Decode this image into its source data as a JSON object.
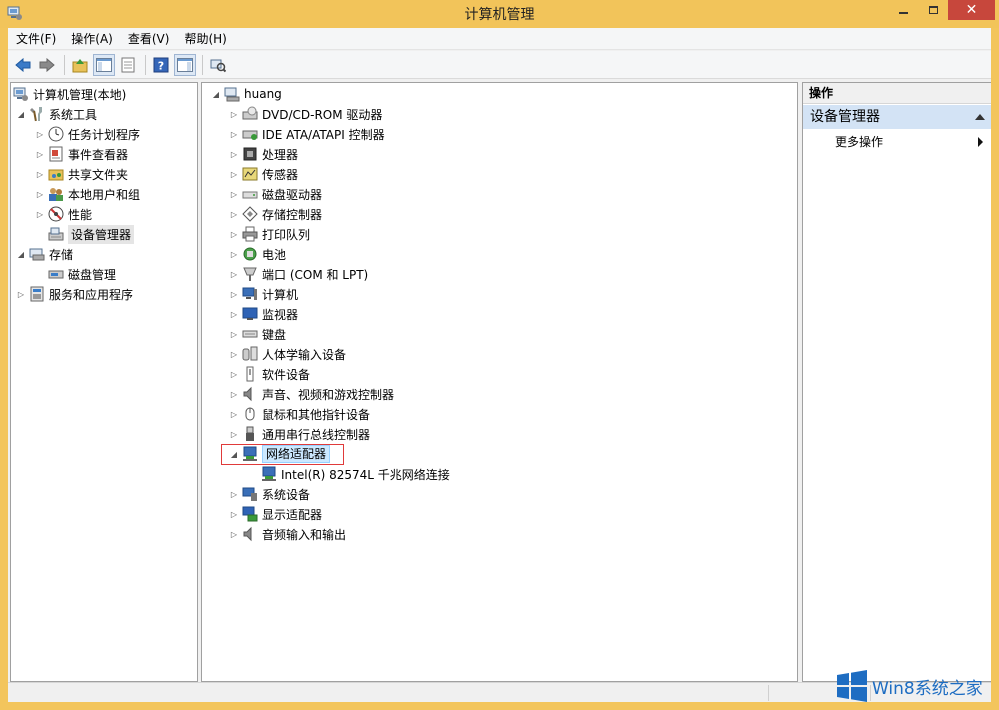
{
  "window": {
    "title": "计算机管理"
  },
  "menu": [
    "文件(F)",
    "操作(A)",
    "查看(V)",
    "帮助(H)"
  ],
  "left_tree": {
    "root": "计算机管理(本地)",
    "system_tools": "系统工具",
    "task_scheduler": "任务计划程序",
    "event_viewer": "事件查看器",
    "shared_folders": "共享文件夹",
    "local_users": "本地用户和组",
    "performance": "性能",
    "device_manager": "设备管理器",
    "storage": "存储",
    "disk_management": "磁盘管理",
    "services_apps": "服务和应用程序"
  },
  "device_tree": {
    "computer_name": "huang",
    "categories": [
      "DVD/CD-ROM 驱动器",
      "IDE ATA/ATAPI 控制器",
      "处理器",
      "传感器",
      "磁盘驱动器",
      "存储控制器",
      "打印队列",
      "电池",
      "端口 (COM 和 LPT)",
      "计算机",
      "监视器",
      "键盘",
      "人体学输入设备",
      "软件设备",
      "声音、视频和游戏控制器",
      "鼠标和其他指针设备",
      "通用串行总线控制器",
      "网络适配器",
      "系统设备",
      "显示适配器",
      "音频输入和输出"
    ],
    "network_child": "Intel(R) 82574L 千兆网络连接"
  },
  "actions": {
    "header": "操作",
    "section": "设备管理器",
    "more": "更多操作"
  },
  "watermark": {
    "text": "Win8系统之家"
  }
}
